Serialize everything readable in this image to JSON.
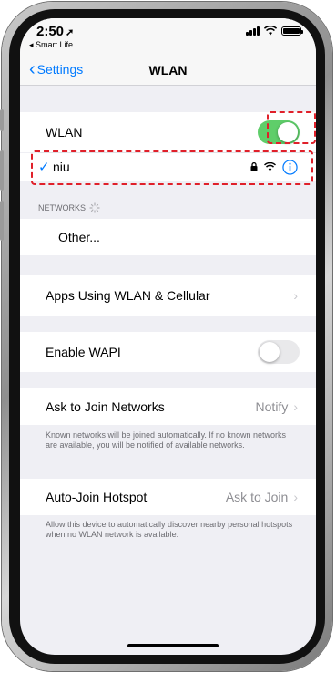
{
  "status_bar": {
    "time": "2:50",
    "back_app": "◂ Smart Life"
  },
  "nav": {
    "back_label": "Settings",
    "title": "WLAN"
  },
  "wlan_toggle": {
    "label": "WLAN",
    "state": "on"
  },
  "connected_network": {
    "name": "niu",
    "secured": true
  },
  "networks_section": {
    "header": "NETWORKS",
    "other_label": "Other..."
  },
  "apps_using": {
    "label": "Apps Using WLAN & Cellular"
  },
  "wapi": {
    "label": "Enable WAPI",
    "state": "off"
  },
  "ask_to_join": {
    "label": "Ask to Join Networks",
    "value": "Notify",
    "footnote": "Known networks will be joined automatically. If no known networks are available, you will be notified of available networks."
  },
  "auto_join": {
    "label": "Auto-Join Hotspot",
    "value": "Ask to Join",
    "footnote": "Allow this device to automatically discover nearby personal hotspots when no WLAN network is available."
  },
  "colors": {
    "accent": "#007aff",
    "toggle_on": "#5fce6a",
    "highlight_dash": "#e0202a",
    "background": "#efeff4"
  }
}
